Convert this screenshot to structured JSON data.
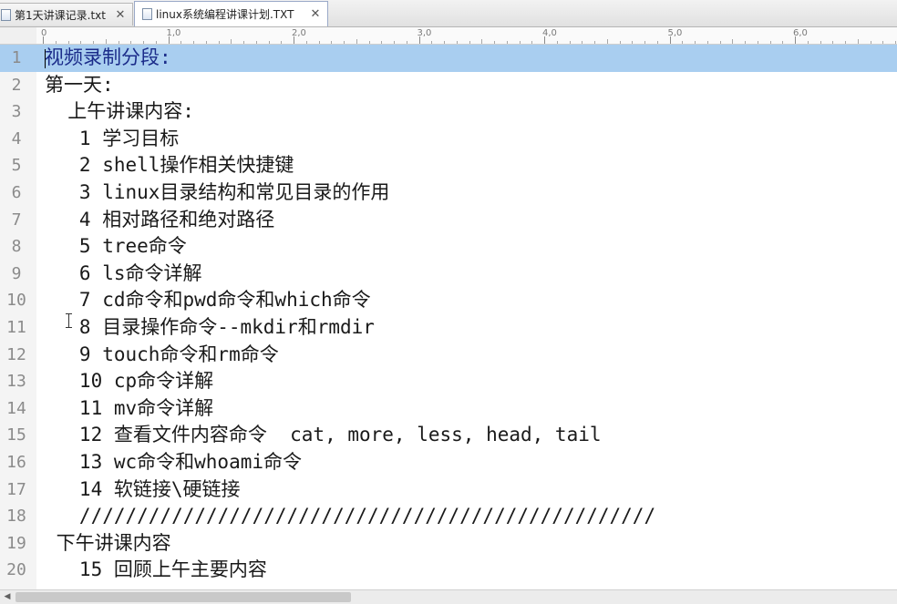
{
  "tabs": [
    {
      "label": "第1天讲课记录.txt",
      "active": false,
      "close": "✕"
    },
    {
      "label": "linux系统编程讲课计划.TXT",
      "active": true,
      "close": "✕"
    }
  ],
  "ruler": {
    "labels": [
      "0",
      "1,0",
      "2,0",
      "3,0",
      "4,0",
      "5,0",
      "6,0"
    ]
  },
  "editor": {
    "current_line": 1,
    "colors": {
      "current_line_bg": "#a9cef0",
      "gutter_text": "#8b8b8b"
    },
    "lines": [
      {
        "num": "1",
        "text": "视频录制分段:"
      },
      {
        "num": "2",
        "text": "第一天:"
      },
      {
        "num": "3",
        "text": "  上午讲课内容:"
      },
      {
        "num": "4",
        "text": "   1 学习目标"
      },
      {
        "num": "5",
        "text": "   2 shell操作相关快捷键"
      },
      {
        "num": "6",
        "text": "   3 linux目录结构和常见目录的作用"
      },
      {
        "num": "7",
        "text": "   4 相对路径和绝对路径"
      },
      {
        "num": "8",
        "text": "   5 tree命令"
      },
      {
        "num": "9",
        "text": "   6 ls命令详解"
      },
      {
        "num": "10",
        "text": "   7 cd命令和pwd命令和which命令"
      },
      {
        "num": "11",
        "text": "   8 目录操作命令--mkdir和rmdir"
      },
      {
        "num": "12",
        "text": "   9 touch命令和rm命令"
      },
      {
        "num": "13",
        "text": "   10 cp命令详解"
      },
      {
        "num": "14",
        "text": "   11 mv命令详解"
      },
      {
        "num": "15",
        "text": "   12 查看文件内容命令  cat, more, less, head, tail"
      },
      {
        "num": "16",
        "text": "   13 wc命令和whoami命令"
      },
      {
        "num": "17",
        "text": "   14 软链接\\硬链接"
      },
      {
        "num": "18",
        "text": "   //////////////////////////////////////////////////"
      },
      {
        "num": "19",
        "text": " 下午讲课内容"
      },
      {
        "num": "20",
        "text": "   15 回顾上午主要内容"
      }
    ]
  },
  "scrollbar": {
    "left_arrow": "◀"
  }
}
